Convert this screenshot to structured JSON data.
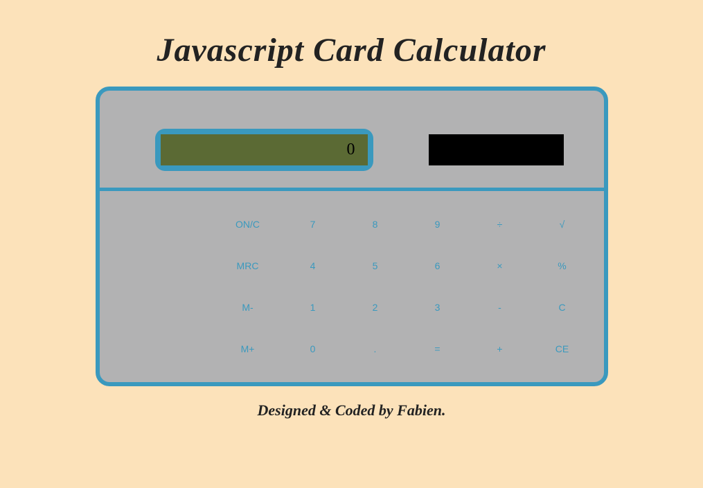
{
  "title": "Javascript Card Calculator",
  "display": "0",
  "buttons": {
    "row1": [
      "ON/C",
      "7",
      "8",
      "9",
      "÷",
      "√"
    ],
    "row2": [
      "MRC",
      "4",
      "5",
      "6",
      "×",
      "%"
    ],
    "row3": [
      "M-",
      "1",
      "2",
      "3",
      "-",
      "C"
    ],
    "row4": [
      "M+",
      "0",
      ".",
      "=",
      "+",
      "CE"
    ]
  },
  "footer": "Designed & Coded by Fabien."
}
